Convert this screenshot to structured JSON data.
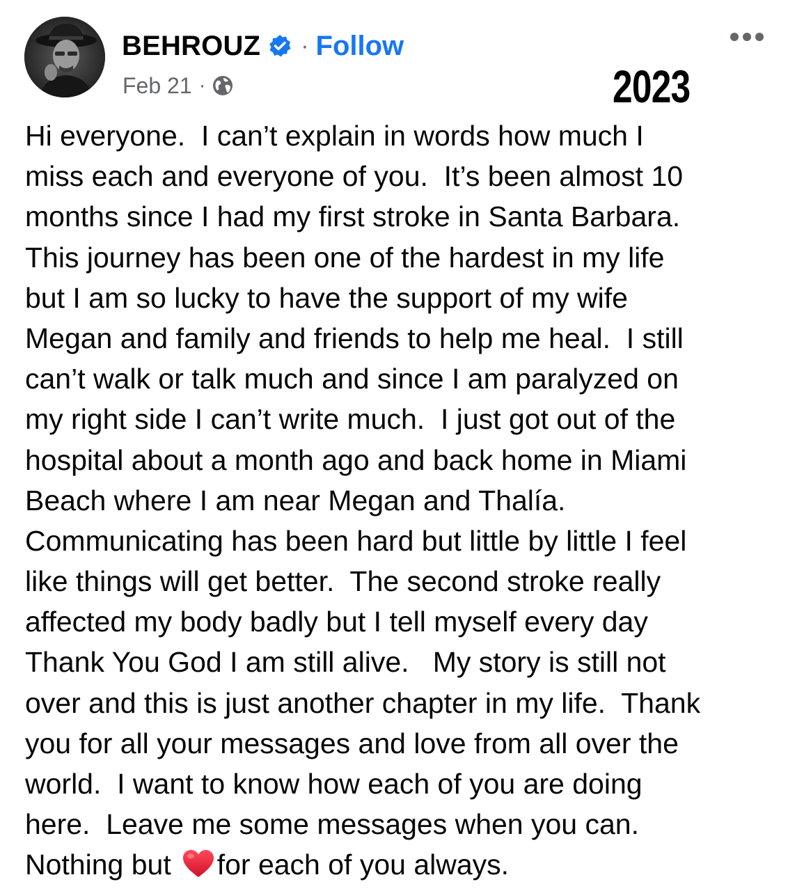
{
  "post": {
    "author": "BEHROUZ",
    "verified_icon": "verified-badge-icon",
    "separator": "·",
    "follow_label": "Follow",
    "date": "Feb 21",
    "meta_separator": "·",
    "audience_icon": "globe-icon",
    "more_icon": "more-options-icon",
    "overlay_year": "2023",
    "body_lines": [
      "Hi everyone.  I can’t explain in words how much I",
      "miss each and everyone of you.  It’s been almost 10",
      "months since I had my first stroke in Santa Barbara.",
      "This journey has been one of the hardest in my life",
      "but I am so lucky to have the support of my wife",
      "Megan and family and friends to help me heal.  I still",
      "can’t walk or talk much and since I am paralyzed on",
      "my right side I can’t write much.  I just got out of the",
      "hospital about a month ago and back home in Miami",
      "Beach where I am near Megan and Thalía.",
      "Communicating has been hard but little by little I feel",
      "like things will get better.  The second stroke really",
      "affected my body badly but I tell myself every day",
      "Thank You God I am still alive.   My story is still not",
      "over and this is just another chapter in my life.  Thank",
      "you for all your messages and love from all over the",
      "world.  I want to know how each of you are doing",
      "here.  Leave me some messages when you can."
    ],
    "last_line_before": "Nothing but",
    "last_line_emoji": "heart-icon",
    "last_line_after": "for each of you always.",
    "colors": {
      "link": "#1877f2",
      "secondary_text": "#65676b",
      "heart": "#e0182d"
    }
  }
}
